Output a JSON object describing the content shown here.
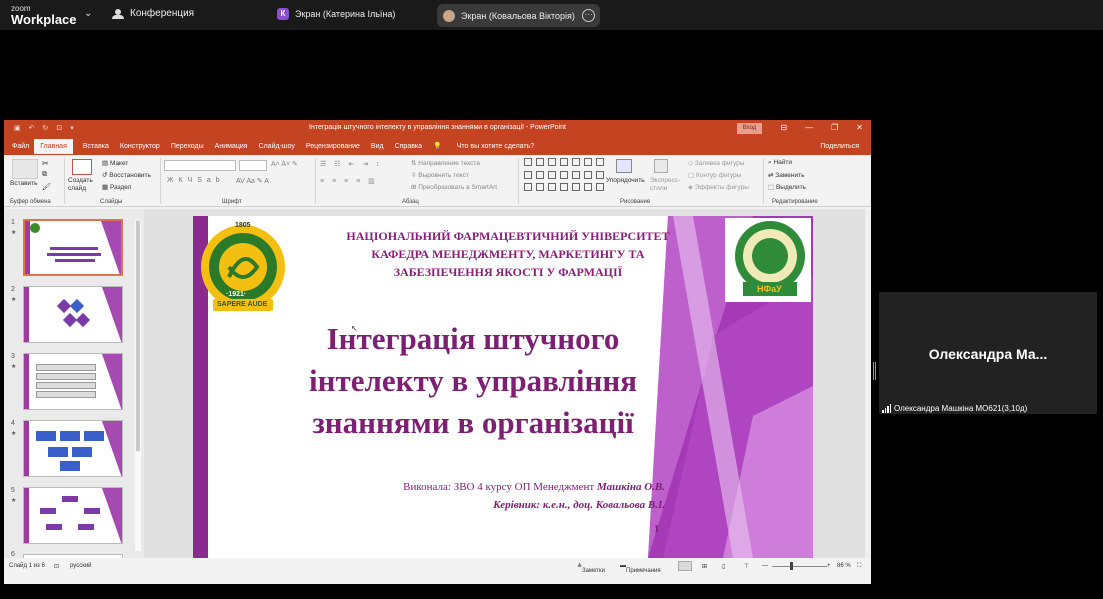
{
  "zoom": {
    "logo_top": "zoom",
    "logo_bottom": "Workplace",
    "conference": "Конференция",
    "tab1_badge": "К",
    "tab1": "Экран (Катерина Ільїна)",
    "tab2": "Экран (Ковальова Вікторія)"
  },
  "ppt": {
    "title": "Інтеграція штучного інтелекту в управління знаннями в організації  -  PowerPoint",
    "login": "Вход",
    "menu": [
      "Файл",
      "Главная",
      "Вставка",
      "Конструктор",
      "Переходы",
      "Анимация",
      "Слайд-шоу",
      "Рецензирование",
      "Вид",
      "Справка"
    ],
    "tell_me": "Что вы хотите сделать?",
    "share": "Поделиться",
    "ribbon": {
      "paste": "Вставить",
      "clipboard": "Буфер обмена",
      "new_slide": "Создать слайд",
      "layout": "Макет",
      "reset": "Восстановить",
      "section": "Раздел",
      "slides": "Слайды",
      "font": "Шрифт",
      "paragraph": "Абзац",
      "text_direction": "Направление текста",
      "align_text": "Выровнять текст",
      "smartart": "Преобразовать в SmartArt",
      "arrange": "Упорядочить",
      "quick_styles": "Экспресс-стили",
      "shape_fill": "Заливка фигуры",
      "shape_outline": "Контур фигуры",
      "shape_effects": "Эффекты фигуры",
      "drawing": "Рисование",
      "find": "Найти",
      "replace": "Заменить",
      "select": "Выделить",
      "editing": "Редактирование"
    },
    "thumbnails": [
      {
        "num": "1",
        "star": "★"
      },
      {
        "num": "2",
        "star": "★"
      },
      {
        "num": "3",
        "star": "★"
      },
      {
        "num": "4",
        "star": "★"
      },
      {
        "num": "5",
        "star": "★"
      },
      {
        "num": "6",
        "star": ""
      }
    ],
    "slide": {
      "univ_line1": "НАЦІОНАЛЬНИЙ ФАРМАЦЕВТИЧНИЙ УНІВЕРСИТЕТ",
      "univ_line2": "КАФЕДРА МЕНЕДЖМЕНТУ, МАРКЕТИНГУ ТА",
      "univ_line3": "ЗАБЕЗПЕЧЕННЯ ЯКОСТІ У ФАРМАЦІЇ",
      "title": "Інтеграція штучного інтелекту в управління знаннями в організації",
      "author_prefix": "Виконала: ЗВО 4 курсу ОП Менеджмент ",
      "author_name": "Машкіна О.В.",
      "supervisor": "Керівник: к.е.н., доц. Ковальова В.І.",
      "page": "1",
      "logo_left_year": "1805",
      "logo_left_year2": "·1921·",
      "logo_left_motto": "SAPERE AUDE",
      "logo_right": "НФаУ"
    },
    "status": {
      "slide": "Слайд 1 из 6",
      "lang": "русский",
      "notes": "Заметки",
      "comments": "Примечания",
      "zoom": "86 %"
    }
  },
  "participant": {
    "name_short": "Олександра Ма...",
    "label": "Олександра Машкіна МО621(3,10д)"
  }
}
